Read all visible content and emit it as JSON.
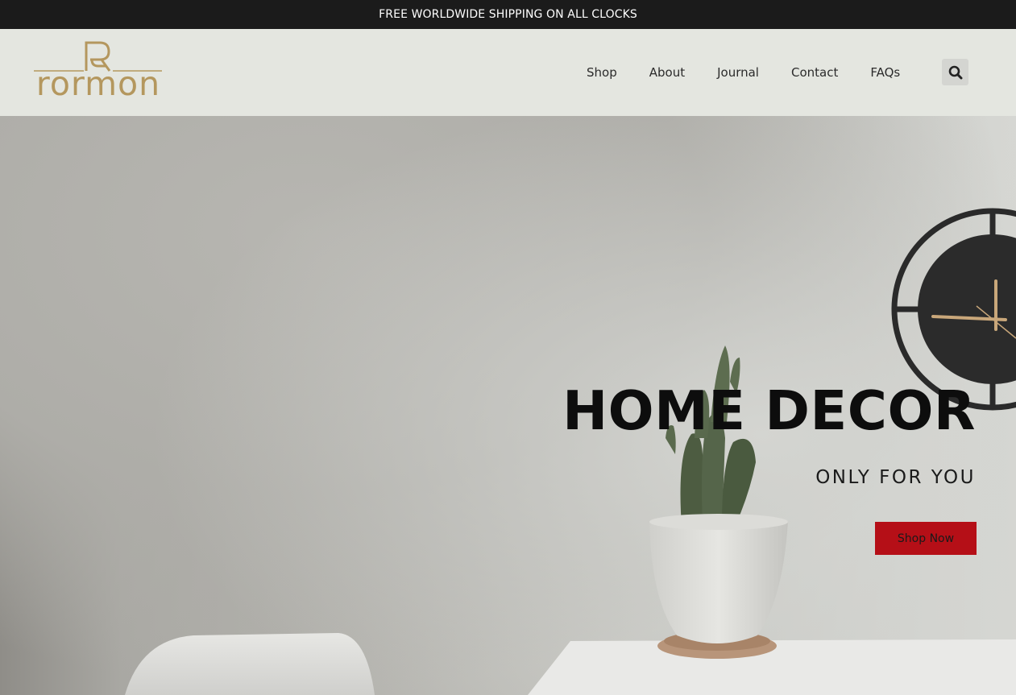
{
  "announcement": {
    "text": "FREE WORLDWIDE SHIPPING ON ALL CLOCKS"
  },
  "header": {
    "logo_text": "rormon",
    "nav": [
      {
        "label": "Shop"
      },
      {
        "label": "About"
      },
      {
        "label": "Journal"
      },
      {
        "label": "Contact"
      },
      {
        "label": "FAQs"
      }
    ],
    "search_icon": "search-icon"
  },
  "hero": {
    "title": "HOME DECOR",
    "subtitle": "ONLY FOR YOU",
    "cta_label": "Shop Now"
  },
  "colors": {
    "topbar_bg": "#1b1b1b",
    "header_bg": "#e4e6e0",
    "brand_gold": "#b4975e",
    "cta_red": "#b50f17"
  }
}
